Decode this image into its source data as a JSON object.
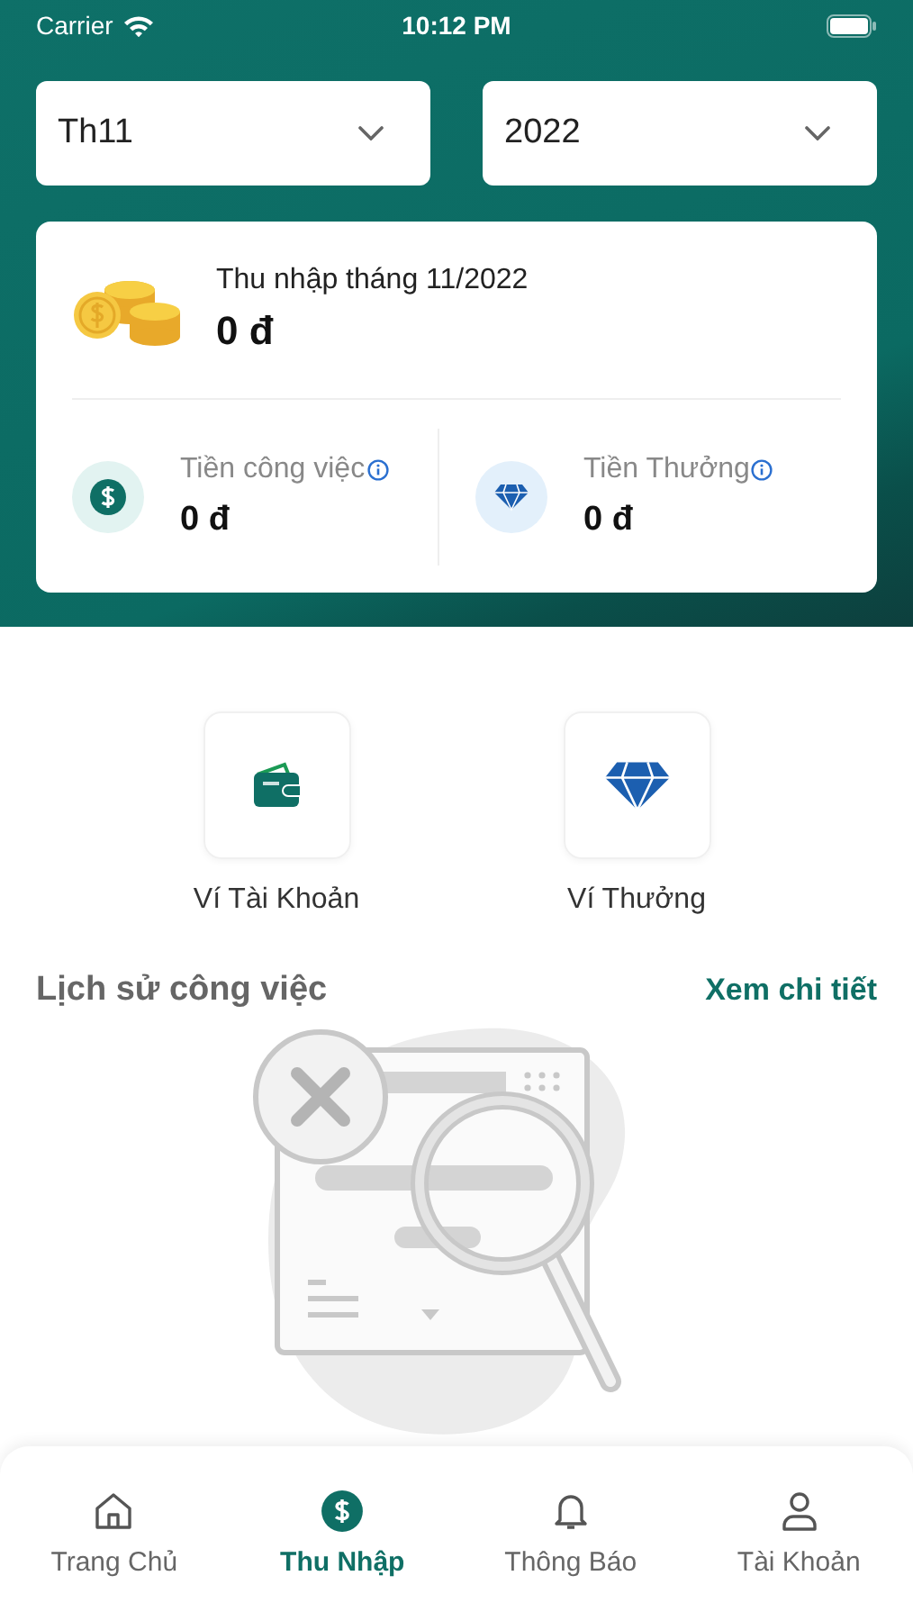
{
  "status_bar": {
    "carrier": "Carrier",
    "time": "10:12 PM"
  },
  "filters": [
    {
      "value": "Th11"
    },
    {
      "value": "2022"
    }
  ],
  "income_card": {
    "title": "Thu nhập tháng 11/2022",
    "amount": "0 đ",
    "breakdown": [
      {
        "kind": "dollar",
        "label": "Tiền công việc",
        "amount": "0 đ"
      },
      {
        "kind": "diamond",
        "label": "Tiền Thưởng",
        "amount": "0 đ"
      }
    ]
  },
  "wallets": [
    {
      "kind": "wallet",
      "label": "Ví Tài Khoản"
    },
    {
      "kind": "diamond",
      "label": "Ví Thưởng"
    }
  ],
  "history": {
    "title": "Lịch sử công việc",
    "link": "Xem chi tiết"
  },
  "tab_bar": [
    {
      "kind": "home",
      "label": "Trang Chủ",
      "selected": false
    },
    {
      "kind": "dollar",
      "label": "Thu Nhập",
      "selected": true
    },
    {
      "kind": "bell",
      "label": "Thông Báo",
      "selected": false
    },
    {
      "kind": "person",
      "label": "Tài Khoản",
      "selected": false
    }
  ]
}
